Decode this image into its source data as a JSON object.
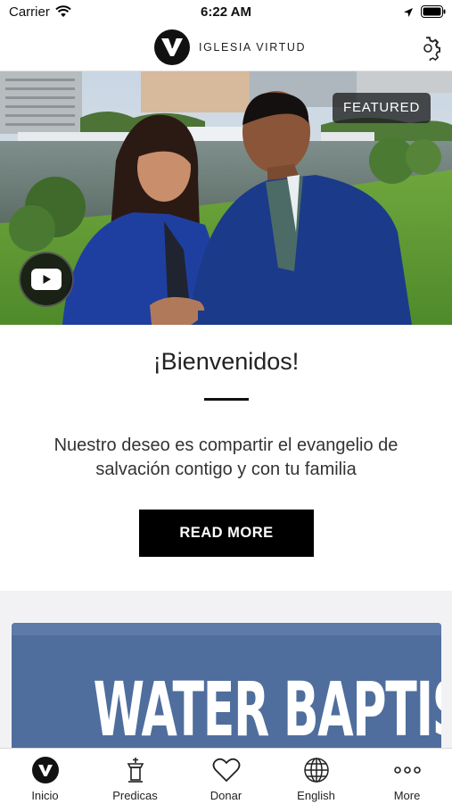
{
  "status_bar": {
    "carrier": "Carrier",
    "time": "6:22 AM"
  },
  "header": {
    "app_name": "IGLESIA VIRTUD",
    "logo_letter": "V"
  },
  "hero": {
    "badge": "FEATURED",
    "video_icon": "youtube-icon"
  },
  "welcome": {
    "title": "¡Bienvenidos!",
    "body": "Nuestro deseo es compartir el evangelio de salvación contigo y con tu familia",
    "button": "READ MORE"
  },
  "next_card": {
    "title": "WATER BAPTISM",
    "color": "#4f6e9d"
  },
  "tabs": [
    {
      "label": "Inicio",
      "icon": "home-v-icon"
    },
    {
      "label": "Predicas",
      "icon": "pulpit-icon"
    },
    {
      "label": "Donar",
      "icon": "heart-icon"
    },
    {
      "label": "English",
      "icon": "globe-icon"
    },
    {
      "label": "More",
      "icon": "more-icon"
    }
  ],
  "colors": {
    "accent": "#000000",
    "card_blue": "#4f6e9d"
  }
}
